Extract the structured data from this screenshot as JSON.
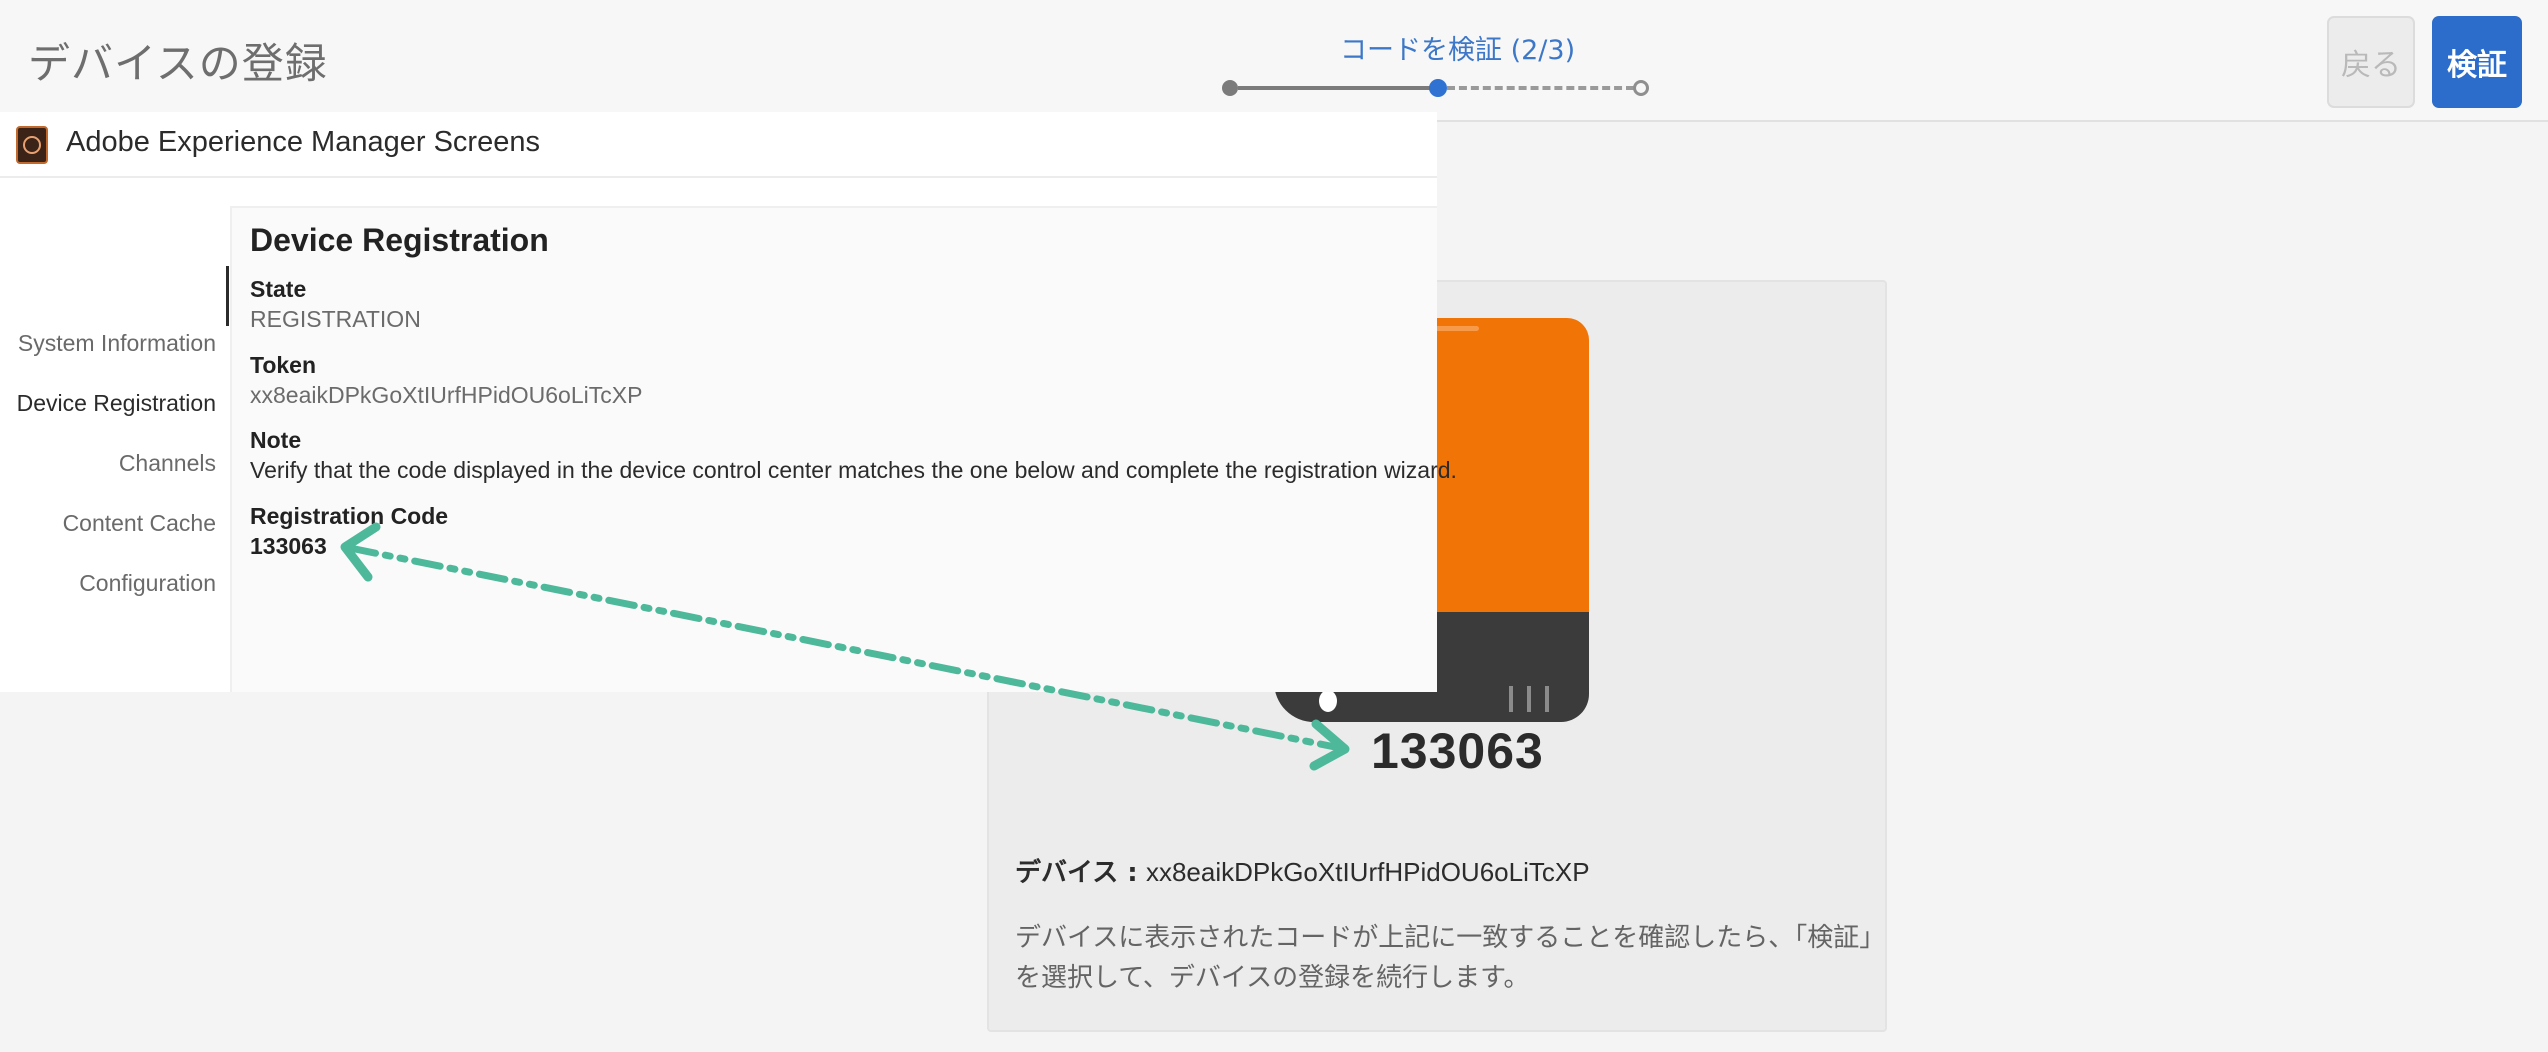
{
  "header": {
    "title": "デバイスの登録",
    "step_label": "コードを検証 (2/3)",
    "back_label": "戻る",
    "verify_label": "検証"
  },
  "aem": {
    "app_title": "Adobe Experience Manager Screens",
    "nav": [
      {
        "label": "System Information"
      },
      {
        "label": "Device Registration"
      },
      {
        "label": "Channels"
      },
      {
        "label": "Content Cache"
      },
      {
        "label": "Configuration"
      }
    ],
    "active_nav": "Device Registration",
    "section_title": "Device Registration",
    "state_label": "State",
    "state_value": "REGISTRATION",
    "token_label": "Token",
    "token_value": "xx8eaikDPkGoXtIUrfHPidOU6oLiTcXP",
    "note_label": "Note",
    "note_value": "Verify that the code displayed in the device control center matches the one below and complete the registration wizard.",
    "code_label": "Registration Code",
    "code_value": "133063"
  },
  "wizard": {
    "device_code": "133063",
    "device_label": "デバイス :",
    "device_token": "xx8eaikDPkGoXtIUrfHPidOU6oLiTcXP",
    "instruction": "デバイスに表示されたコードが上記に一致することを確認したら、「検証」を選択して、デバイスの登録を続行します。"
  },
  "colors": {
    "accent_blue": "#2c6ccb",
    "device_orange": "#f07406",
    "arrow_teal": "#4db89a"
  },
  "icons": {
    "app_logo": "aem-screens-logo-icon",
    "arrow": "double-headed-dashdot-arrow-icon"
  }
}
